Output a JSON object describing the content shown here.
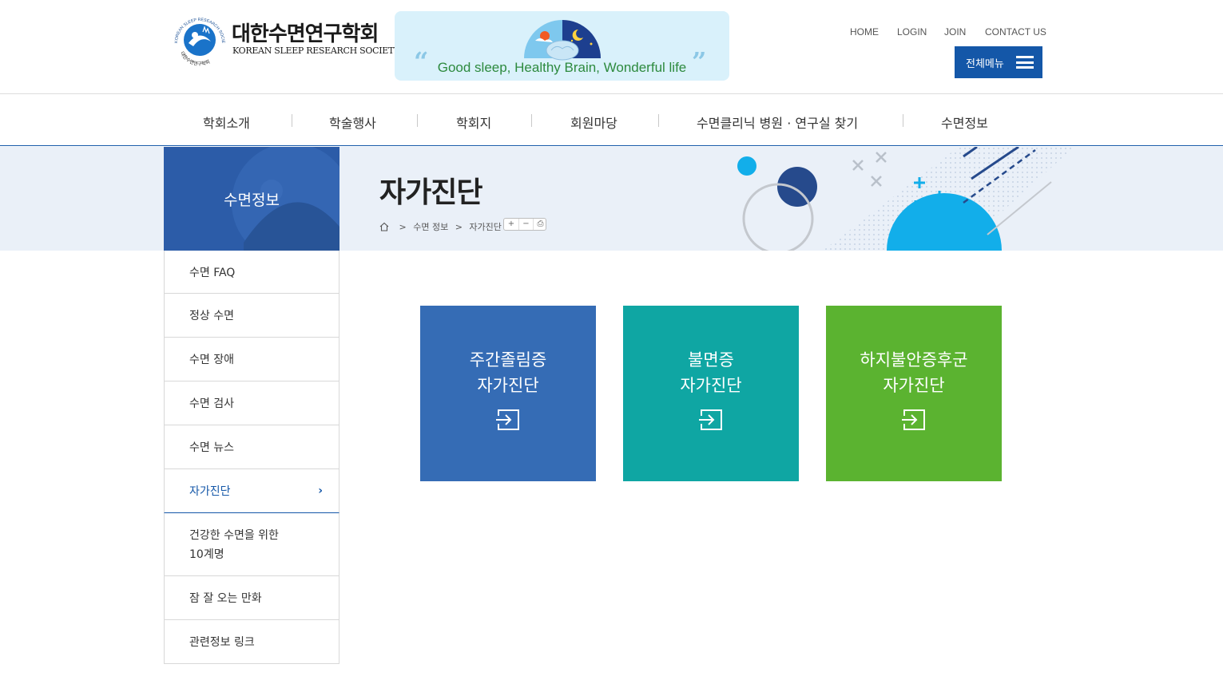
{
  "header": {
    "logo_ko": "대한수면연구학회",
    "logo_en": "KOREAN SLEEP RESEARCH SOCIETY",
    "logo_arc_top": "KOREAN SLEEP RESEARCH SOCIETY",
    "logo_arc_bottom": "대한수면연구학회",
    "banner_slogan": "Good sleep, Healthy Brain, Wonderful life",
    "util_links": [
      "HOME",
      "LOGIN",
      "JOIN",
      "CONTACT US"
    ],
    "all_menu_label": "전체메뉴"
  },
  "gnb": {
    "items": [
      "학회소개",
      "학술행사",
      "학회지",
      "회원마당",
      "수면클리닉 병원 · 연구실 찾기",
      "수면정보"
    ]
  },
  "subvisual": {
    "section_title": "수면정보",
    "page_title": "자가진단",
    "breadcrumb": [
      "수면 정보",
      "자가진단"
    ],
    "breadcrumb_sep": ">",
    "tools": [
      "+",
      "−",
      "⎙"
    ]
  },
  "lnb": {
    "items": [
      {
        "label": "수면 FAQ",
        "active": false
      },
      {
        "label": "정상 수면",
        "active": false
      },
      {
        "label": "수면 장애",
        "active": false
      },
      {
        "label": "수면 검사",
        "active": false
      },
      {
        "label": "수면 뉴스",
        "active": false
      },
      {
        "label": "자가진단",
        "active": true
      },
      {
        "label_l1": "건강한 수면을 위한",
        "label_l2": "10계명",
        "active": false
      },
      {
        "label": "잠 잘 오는 만화",
        "active": false
      },
      {
        "label": "관련정보 링크",
        "active": false
      }
    ],
    "active_arrow": "›"
  },
  "cards": [
    {
      "line1": "주간졸림증",
      "line2": "자가진단",
      "color": "#356cb5"
    },
    {
      "line1": "불면증",
      "line2": "자가진단",
      "color": "#0fa6a3"
    },
    {
      "line1": "하지불안증후군",
      "line2": "자가진단",
      "color": "#5bb330"
    }
  ],
  "colors": {
    "brand_blue": "#1457a8",
    "section_blue": "#2c5ca8",
    "subvisual_bg": "#eaf0f8"
  }
}
